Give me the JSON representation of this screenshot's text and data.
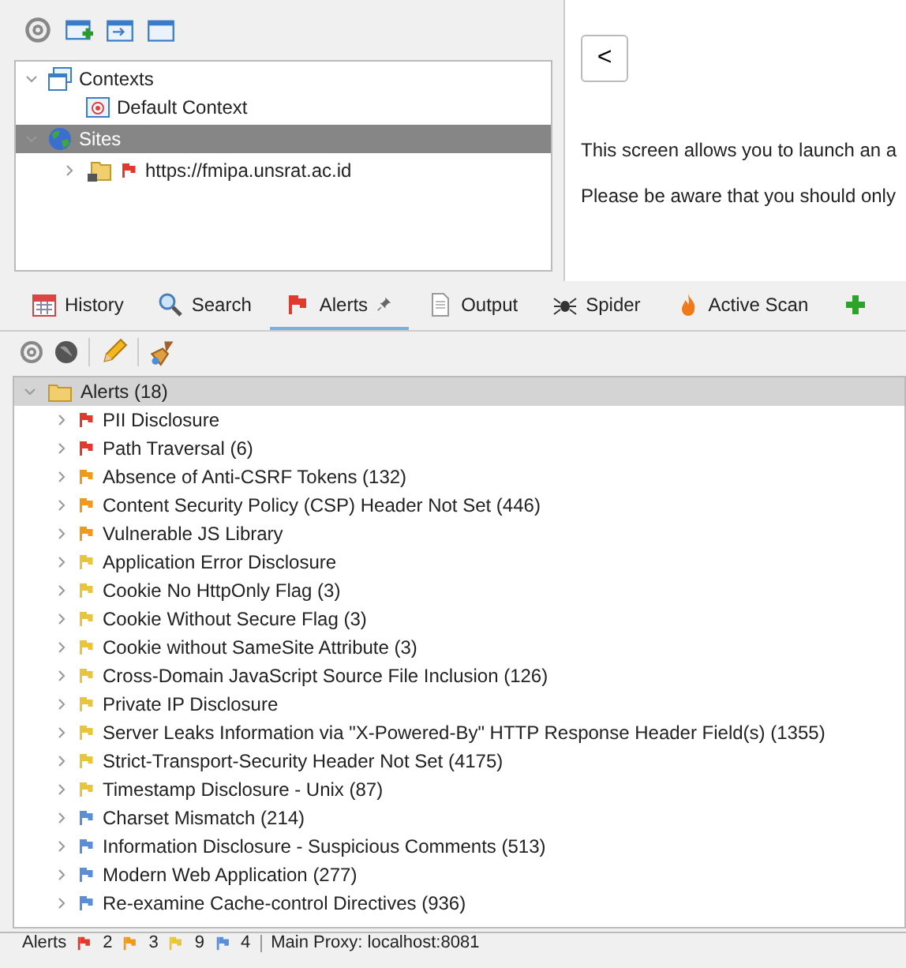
{
  "context_tree": [
    {
      "label": "Contexts",
      "expanded": true,
      "selected": false,
      "children": [
        {
          "label": "Default Context",
          "selected": false
        }
      ]
    },
    {
      "label": "Sites",
      "expanded": true,
      "selected": true,
      "children": [
        {
          "label": "https://fmipa.unsrat.ac.id",
          "expanded": false,
          "selected": false
        }
      ]
    }
  ],
  "quick_start": {
    "back_button": "<",
    "paragraphs": [
      "This screen allows you to launch an a",
      "Please be aware that you should only"
    ]
  },
  "tabs": [
    {
      "label": "History",
      "kind": "history",
      "selected": false,
      "pinned": false
    },
    {
      "label": "Search",
      "kind": "search",
      "selected": false,
      "pinned": false
    },
    {
      "label": "Alerts",
      "kind": "alerts",
      "selected": true,
      "pinned": true
    },
    {
      "label": "Output",
      "kind": "output",
      "selected": false,
      "pinned": false
    },
    {
      "label": "Spider",
      "kind": "spider",
      "selected": false,
      "pinned": false
    },
    {
      "label": "Active Scan",
      "kind": "scan",
      "selected": false,
      "pinned": false
    }
  ],
  "alerts": {
    "label": "Alerts (18)",
    "expanded": true,
    "items": [
      {
        "label": "PII Disclosure",
        "color": "#e2382e"
      },
      {
        "label": "Path Traversal (6)",
        "color": "#e2382e"
      },
      {
        "label": "Absence of Anti-CSRF Tokens (132)",
        "color": "#f09a1c"
      },
      {
        "label": "Content Security Policy (CSP) Header Not Set (446)",
        "color": "#f09a1c"
      },
      {
        "label": "Vulnerable JS Library",
        "color": "#f09a1c"
      },
      {
        "label": "Application Error Disclosure",
        "color": "#e8c53a"
      },
      {
        "label": "Cookie No HttpOnly Flag (3)",
        "color": "#e8c53a"
      },
      {
        "label": "Cookie Without Secure Flag (3)",
        "color": "#e8c53a"
      },
      {
        "label": "Cookie without SameSite Attribute (3)",
        "color": "#e8c53a"
      },
      {
        "label": "Cross-Domain JavaScript Source File Inclusion (126)",
        "color": "#e8c53a"
      },
      {
        "label": "Private IP Disclosure",
        "color": "#e8c53a"
      },
      {
        "label": "Server Leaks Information via \"X-Powered-By\" HTTP Response Header Field(s) (1355)",
        "color": "#e8c53a"
      },
      {
        "label": "Strict-Transport-Security Header Not Set (4175)",
        "color": "#e8c53a"
      },
      {
        "label": "Timestamp Disclosure - Unix (87)",
        "color": "#e8c53a"
      },
      {
        "label": "Charset Mismatch  (214)",
        "color": "#5a8fd6"
      },
      {
        "label": "Information Disclosure - Suspicious Comments (513)",
        "color": "#5a8fd6"
      },
      {
        "label": "Modern Web Application (277)",
        "color": "#5a8fd6"
      },
      {
        "label": "Re-examine Cache-control Directives (936)",
        "color": "#5a8fd6"
      }
    ]
  },
  "status_bar": {
    "label": "Alerts",
    "counts": [
      {
        "value": "2",
        "color": "#e2382e"
      },
      {
        "value": "3",
        "color": "#f09a1c"
      },
      {
        "value": "9",
        "color": "#e8c53a"
      },
      {
        "value": "4",
        "color": "#5a8fd6"
      }
    ],
    "proxy": "Main Proxy: localhost:8081"
  }
}
